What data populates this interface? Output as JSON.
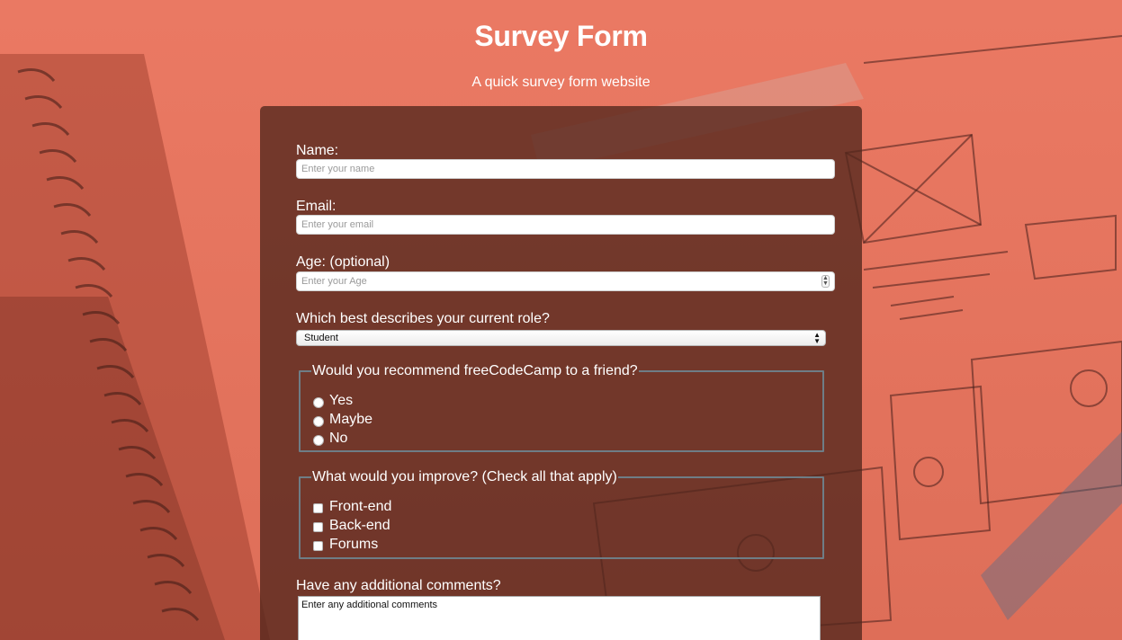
{
  "header": {
    "title": "Survey Form",
    "subtitle": "A quick survey form website"
  },
  "form": {
    "name": {
      "label": "Name:",
      "placeholder": "Enter your name"
    },
    "email": {
      "label": "Email:",
      "placeholder": "Enter your email"
    },
    "age": {
      "label": "Age: (optional)",
      "placeholder": "Enter your Age"
    },
    "role": {
      "label": "Which best describes your current role?",
      "selected": "Student"
    },
    "recommend": {
      "legend": "Would you recommend freeCodeCamp to a friend?",
      "options": [
        "Yes",
        "Maybe",
        "No"
      ]
    },
    "improve": {
      "legend": "What would you improve? (Check all that apply)",
      "options": [
        "Front-end",
        "Back-end",
        "Forums"
      ]
    },
    "comments": {
      "label": "Have any additional comments?",
      "placeholder": "Enter any additional comments"
    }
  },
  "colors": {
    "background_tint": "#e97a63",
    "panel": "#52261c",
    "fieldset_border": "#6e7d86",
    "text": "#ffffff"
  }
}
